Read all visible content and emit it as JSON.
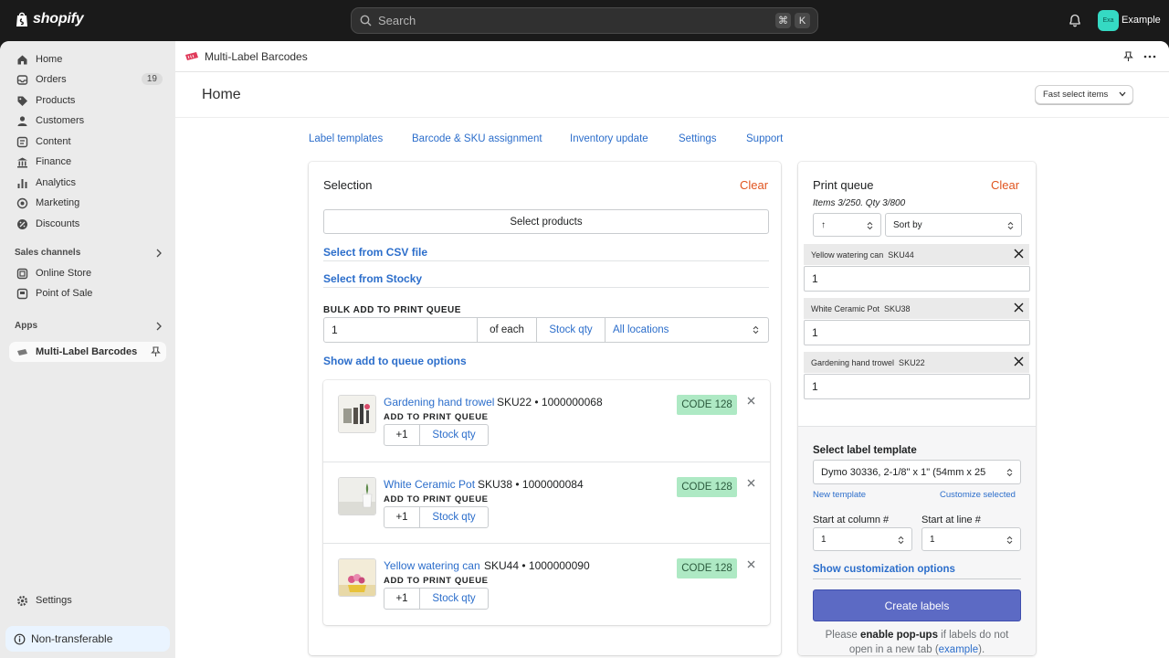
{
  "topbar": {
    "brand": "shopify",
    "search_placeholder": "Search",
    "shortcut_keys": [
      "⌘",
      "K"
    ],
    "avatar_initials": "Exa",
    "store_name": "Example"
  },
  "sidebar": {
    "items": [
      {
        "label": "Home",
        "icon": "home-icon"
      },
      {
        "label": "Orders",
        "icon": "orders-icon",
        "badge": "19"
      },
      {
        "label": "Products",
        "icon": "tag-icon"
      },
      {
        "label": "Customers",
        "icon": "person-icon"
      },
      {
        "label": "Content",
        "icon": "content-icon"
      },
      {
        "label": "Finance",
        "icon": "bank-icon"
      },
      {
        "label": "Analytics",
        "icon": "bar-chart-icon"
      },
      {
        "label": "Marketing",
        "icon": "target-icon"
      },
      {
        "label": "Discounts",
        "icon": "discount-icon"
      }
    ],
    "sales_channels_label": "Sales channels",
    "channels": [
      {
        "label": "Online Store",
        "icon": "store-icon"
      },
      {
        "label": "Point of Sale",
        "icon": "pos-icon"
      }
    ],
    "apps_label": "Apps",
    "apps": [
      {
        "label": "Multi-Label Barcodes",
        "icon": "app-icon"
      }
    ],
    "settings_label": "Settings",
    "non_transferable_label": "Non-transferable"
  },
  "app": {
    "title": "Multi-Label Barcodes",
    "page_title": "Home",
    "fast_select_label": "Fast select items",
    "tabs": [
      "Label templates",
      "Barcode & SKU assignment",
      "Inventory update",
      "Settings",
      "Support"
    ]
  },
  "selection": {
    "title": "Selection",
    "clear_label": "Clear",
    "select_products_label": "Select products",
    "csv_link": "Select from CSV file",
    "stocky_link": "Select from Stocky",
    "bulk_label": "BULK ADD TO PRINT QUEUE",
    "bulk_qty": "1",
    "of_each_label": "of each",
    "stock_qty_label": "Stock qty",
    "locations_value": "All locations",
    "show_options_link": "Show add to queue options",
    "items": [
      {
        "name": "Gardening hand trowel",
        "meta": "SKU22 • 1000000068",
        "apq_label": "ADD TO PRINT QUEUE",
        "plus_label": "+1",
        "stock_label": "Stock qty",
        "code": "CODE 128"
      },
      {
        "name": "White Ceramic Pot",
        "meta": "SKU38 • 1000000084",
        "apq_label": "ADD TO PRINT QUEUE",
        "plus_label": "+1",
        "stock_label": "Stock qty",
        "code": "CODE 128"
      },
      {
        "name": "Yellow watering can",
        "meta": "SKU44 • 1000000090",
        "apq_label": "ADD TO PRINT QUEUE",
        "plus_label": "+1",
        "stock_label": "Stock qty",
        "code": "CODE 128"
      }
    ]
  },
  "print_queue": {
    "title": "Print queue",
    "clear_label": "Clear",
    "summary": "Items 3/250. Qty 3/800",
    "sort_dir_value": "↑",
    "sort_by_value": "Sort by",
    "items": [
      {
        "label": "Yellow watering can  SKU44",
        "qty": "1"
      },
      {
        "label": "White Ceramic Pot  SKU38",
        "qty": "1"
      },
      {
        "label": "Gardening hand trowel  SKU22",
        "qty": "1"
      }
    ],
    "template_label": "Select label template",
    "template_value": "Dymo 30336, 2-1/8\" x 1\" (54mm x 25",
    "new_template_link": "New template",
    "customize_link": "Customize selected",
    "start_column_label": "Start at column #",
    "start_column_value": "1",
    "start_line_label": "Start at line #",
    "start_line_value": "1",
    "show_custom_link": "Show customization options",
    "create_button": "Create labels",
    "note_prefix": "Please ",
    "note_bold": "enable pop-ups",
    "note_middle": " if labels do not open in a new tab (",
    "note_link": "example",
    "note_suffix": ")."
  },
  "colors": {
    "accent_blue": "#2c6ecb",
    "clear_orange": "#e0541f",
    "primary_button": "#5c6ac4",
    "code_badge": "#aee9c4"
  }
}
